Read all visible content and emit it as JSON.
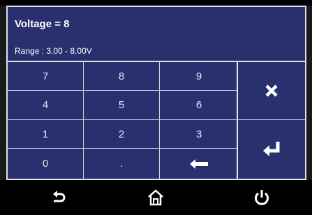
{
  "header": {
    "title": "Voltage = 8",
    "range": "Range : 3.00 - 8.00V"
  },
  "keypad": {
    "rows": [
      [
        "7",
        "8",
        "9"
      ],
      [
        "4",
        "5",
        "6"
      ],
      [
        "1",
        "2",
        "3"
      ],
      [
        "0",
        ".",
        ""
      ]
    ]
  },
  "icons": {
    "backspace": "left-arrow-icon",
    "clear": "close-icon",
    "enter": "enter-icon",
    "back": "undo-arrow-icon",
    "home": "home-icon",
    "power": "power-icon"
  },
  "colors": {
    "panel": "#2a2f6e",
    "border": "#dfe3ea",
    "bar": "#000000"
  }
}
